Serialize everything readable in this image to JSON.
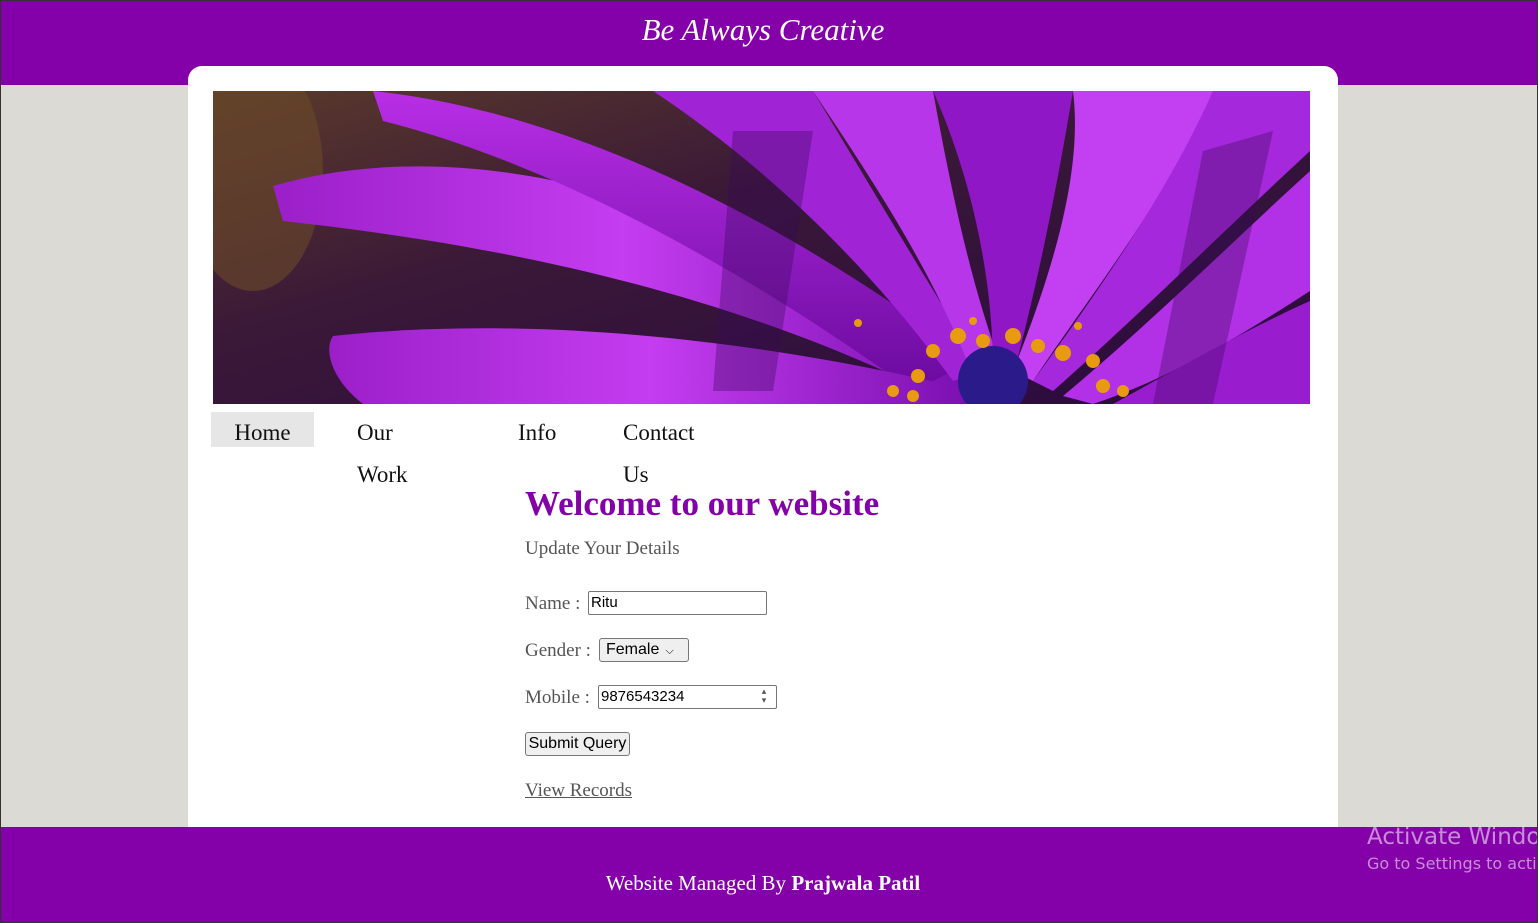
{
  "header": {
    "title": "Be Always Creative"
  },
  "nav": {
    "items": [
      "Home",
      "Our Work",
      "Info",
      "Contact Us"
    ],
    "active": "Home"
  },
  "main": {
    "heading": "Welcome to our website",
    "subtitle": "Update Your Details",
    "form": {
      "name_label": "Name :",
      "name_value": "Ritu",
      "gender_label": "Gender :",
      "gender_value": "Female",
      "mobile_label": "Mobile :",
      "mobile_value": "9876543234",
      "submit_label": "Submit Query"
    },
    "view_records": "View Records"
  },
  "footer": {
    "prefix": "Website Managed By",
    "author": "Prajwala Patil"
  },
  "watermark": {
    "line1": "Activate Windows",
    "line2": "Go to Settings to activate Windows."
  },
  "colors": {
    "brand": "#8400a8",
    "page_bg": "#dcdad5",
    "text_muted": "#555555"
  },
  "banner": {
    "image": "purple-flower-photo"
  }
}
